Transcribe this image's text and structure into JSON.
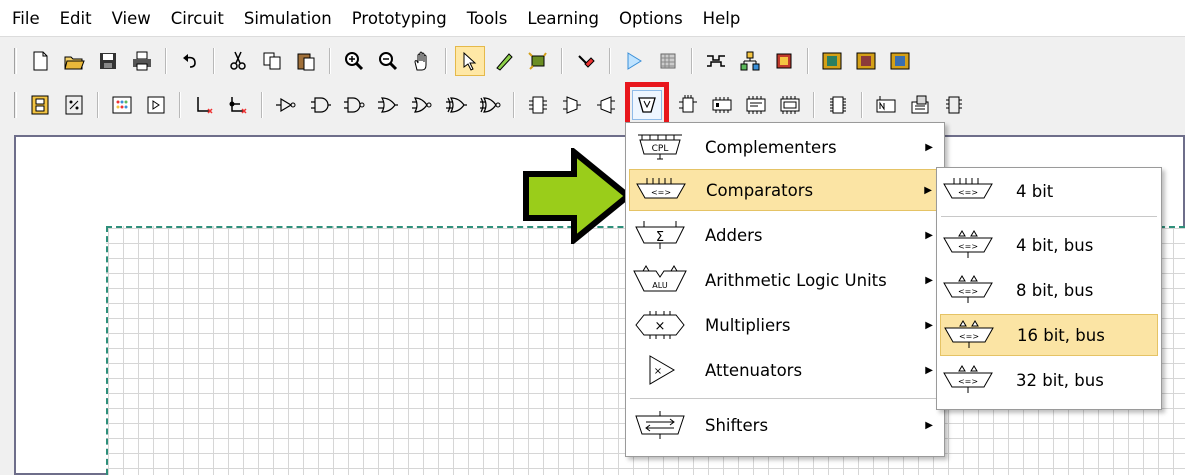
{
  "menubar": {
    "items": [
      "File",
      "Edit",
      "View",
      "Circuit",
      "Simulation",
      "Prototyping",
      "Tools",
      "Learning",
      "Options",
      "Help"
    ]
  },
  "menu": {
    "items": [
      {
        "label": "Complementers",
        "icon": "complementer-icon"
      },
      {
        "label": "Comparators",
        "icon": "comparator-icon",
        "selected": true
      },
      {
        "label": "Adders",
        "icon": "adder-icon"
      },
      {
        "label": "Arithmetic Logic Units",
        "icon": "alu-icon"
      },
      {
        "label": "Multipliers",
        "icon": "multiplier-icon"
      },
      {
        "label": "Attenuators",
        "icon": "attenuator-icon"
      },
      {
        "label": "Shifters",
        "icon": "shifter-icon"
      }
    ],
    "icon_text": {
      "cpl": "CPL",
      "cmp": "<=>",
      "sum": "Σ",
      "alu": "ALU",
      "mul": "×",
      "att": "×"
    }
  },
  "submenu": {
    "items": [
      {
        "label": "4 bit"
      },
      {
        "label": "4 bit, bus"
      },
      {
        "label": "8 bit, bus"
      },
      {
        "label": "16 bit, bus",
        "selected": true
      },
      {
        "label": "32 bit, bus"
      }
    ]
  },
  "colors": {
    "highlight_box": "#e8161c",
    "arrow_fill": "#9acd1a",
    "menu_selected": "#fbe4a4",
    "grid_border": "#2e8f7a"
  }
}
